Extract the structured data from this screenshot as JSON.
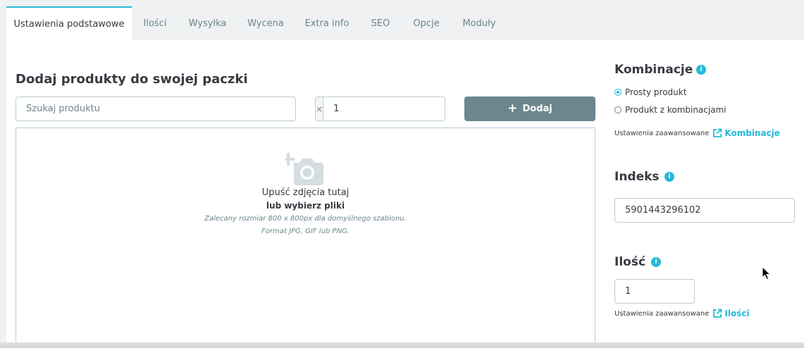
{
  "tabs": [
    {
      "label": "Ustawienia podstawowe",
      "active": true
    },
    {
      "label": "Ilości",
      "active": false
    },
    {
      "label": "Wysyłka",
      "active": false
    },
    {
      "label": "Wycena",
      "active": false
    },
    {
      "label": "Extra info",
      "active": false
    },
    {
      "label": "SEO",
      "active": false
    },
    {
      "label": "Opcje",
      "active": false
    },
    {
      "label": "Moduły",
      "active": false
    }
  ],
  "pack": {
    "title": "Dodaj produkty do swojej paczki",
    "search_placeholder": "Szukaj produktu",
    "qty_prefix": "×",
    "qty_value": "1",
    "add_icon": "+",
    "add_label": "Dodaj"
  },
  "dropzone": {
    "icon": "camera-add-icon",
    "line1": "Upuść zdjęcia tutaj",
    "line2": "lub wybierz pliki",
    "line3": "Zalecany rozmiar 800 x 800px dla domyślnego szablonu.",
    "line4": "Format JPG, GIF lub PNG."
  },
  "combinations": {
    "title": "Kombinacje",
    "info_icon": "i",
    "option_simple": "Prosty produkt",
    "option_combos": "Produkt z kombinacjami",
    "selected": "Prosty produkt",
    "adv_label": "Ustawienia zaawansowane",
    "adv_link": "Kombinacje"
  },
  "index": {
    "title": "Indeks",
    "info_icon": "i",
    "value": "5901443296102"
  },
  "quantity": {
    "title": "Ilość",
    "info_icon": "i",
    "value": "1",
    "adv_label": "Ustawienia zaawansowane",
    "adv_link": "Ilości"
  },
  "colors": {
    "accent": "#25b9d7",
    "button": "#6c868e",
    "text": "#363a41",
    "border": "#bbcdd2",
    "tabbar_bg": "#eff1f2"
  }
}
